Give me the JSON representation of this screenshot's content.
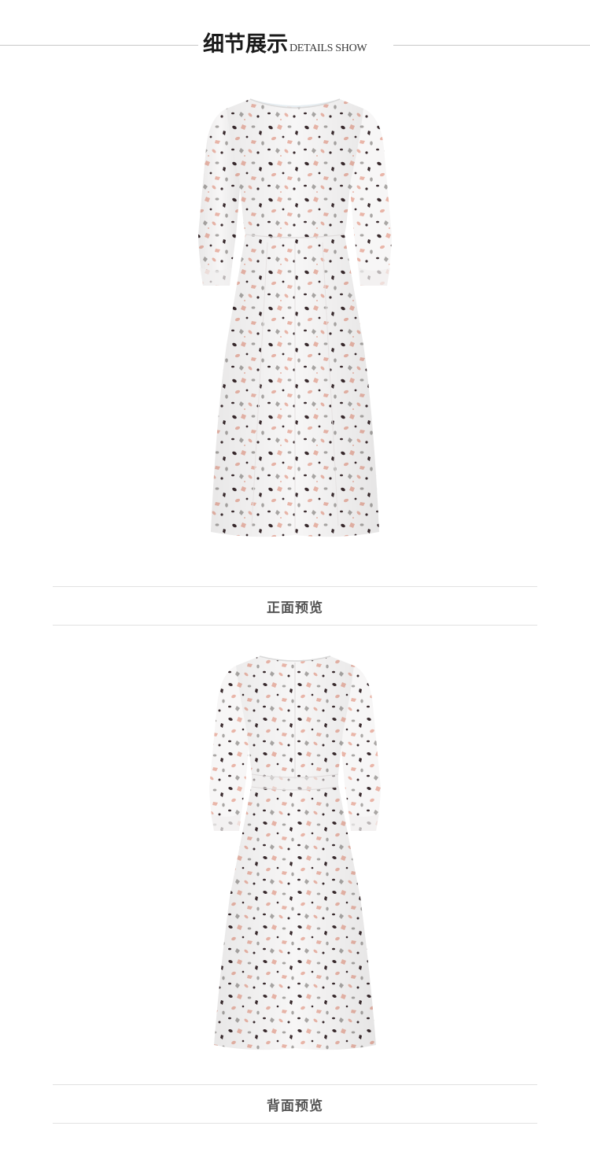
{
  "header": {
    "title_cn": "细节展示",
    "title_en": "DETAILS SHOW"
  },
  "sections": [
    {
      "view": "front",
      "caption": "正面预览",
      "image": "white-midi-dress-front"
    },
    {
      "view": "back",
      "caption": "背面预览",
      "image": "white-midi-dress-back"
    }
  ],
  "colors": {
    "dress_base": "#f7f6f6",
    "print_pink": "#e9b5a8",
    "print_dark": "#3a2b2e",
    "print_grey": "#a9a6a4",
    "divider": "#e1e1e1",
    "caption_text": "#555555"
  }
}
